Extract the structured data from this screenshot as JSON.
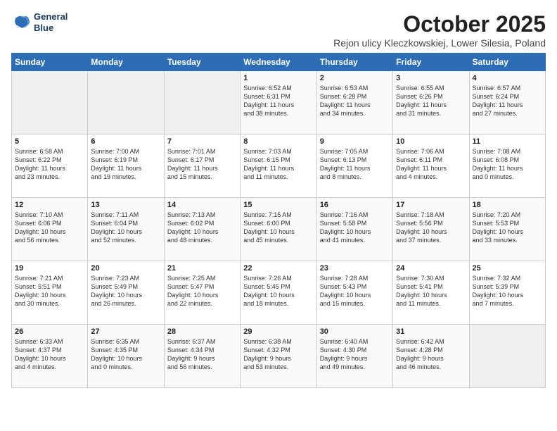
{
  "header": {
    "logo_line1": "General",
    "logo_line2": "Blue",
    "month": "October 2025",
    "location": "Rejon ulicy Kleczkowskiej, Lower Silesia, Poland"
  },
  "days_of_week": [
    "Sunday",
    "Monday",
    "Tuesday",
    "Wednesday",
    "Thursday",
    "Friday",
    "Saturday"
  ],
  "weeks": [
    [
      {
        "day": "",
        "empty": true
      },
      {
        "day": "",
        "empty": true
      },
      {
        "day": "",
        "empty": true
      },
      {
        "day": "1",
        "sunrise": "6:52 AM",
        "sunset": "6:31 PM",
        "daylight": "11 hours and 38 minutes."
      },
      {
        "day": "2",
        "sunrise": "6:53 AM",
        "sunset": "6:28 PM",
        "daylight": "11 hours and 34 minutes."
      },
      {
        "day": "3",
        "sunrise": "6:55 AM",
        "sunset": "6:26 PM",
        "daylight": "11 hours and 31 minutes."
      },
      {
        "day": "4",
        "sunrise": "6:57 AM",
        "sunset": "6:24 PM",
        "daylight": "11 hours and 27 minutes."
      }
    ],
    [
      {
        "day": "5",
        "sunrise": "6:58 AM",
        "sunset": "6:22 PM",
        "daylight": "11 hours and 23 minutes."
      },
      {
        "day": "6",
        "sunrise": "7:00 AM",
        "sunset": "6:19 PM",
        "daylight": "11 hours and 19 minutes."
      },
      {
        "day": "7",
        "sunrise": "7:01 AM",
        "sunset": "6:17 PM",
        "daylight": "11 hours and 15 minutes."
      },
      {
        "day": "8",
        "sunrise": "7:03 AM",
        "sunset": "6:15 PM",
        "daylight": "11 hours and 11 minutes."
      },
      {
        "day": "9",
        "sunrise": "7:05 AM",
        "sunset": "6:13 PM",
        "daylight": "11 hours and 8 minutes."
      },
      {
        "day": "10",
        "sunrise": "7:06 AM",
        "sunset": "6:11 PM",
        "daylight": "11 hours and 4 minutes."
      },
      {
        "day": "11",
        "sunrise": "7:08 AM",
        "sunset": "6:08 PM",
        "daylight": "11 hours and 0 minutes."
      }
    ],
    [
      {
        "day": "12",
        "sunrise": "7:10 AM",
        "sunset": "6:06 PM",
        "daylight": "10 hours and 56 minutes."
      },
      {
        "day": "13",
        "sunrise": "7:11 AM",
        "sunset": "6:04 PM",
        "daylight": "10 hours and 52 minutes."
      },
      {
        "day": "14",
        "sunrise": "7:13 AM",
        "sunset": "6:02 PM",
        "daylight": "10 hours and 48 minutes."
      },
      {
        "day": "15",
        "sunrise": "7:15 AM",
        "sunset": "6:00 PM",
        "daylight": "10 hours and 45 minutes."
      },
      {
        "day": "16",
        "sunrise": "7:16 AM",
        "sunset": "5:58 PM",
        "daylight": "10 hours and 41 minutes."
      },
      {
        "day": "17",
        "sunrise": "7:18 AM",
        "sunset": "5:56 PM",
        "daylight": "10 hours and 37 minutes."
      },
      {
        "day": "18",
        "sunrise": "7:20 AM",
        "sunset": "5:53 PM",
        "daylight": "10 hours and 33 minutes."
      }
    ],
    [
      {
        "day": "19",
        "sunrise": "7:21 AM",
        "sunset": "5:51 PM",
        "daylight": "10 hours and 30 minutes."
      },
      {
        "day": "20",
        "sunrise": "7:23 AM",
        "sunset": "5:49 PM",
        "daylight": "10 hours and 26 minutes."
      },
      {
        "day": "21",
        "sunrise": "7:25 AM",
        "sunset": "5:47 PM",
        "daylight": "10 hours and 22 minutes."
      },
      {
        "day": "22",
        "sunrise": "7:26 AM",
        "sunset": "5:45 PM",
        "daylight": "10 hours and 18 minutes."
      },
      {
        "day": "23",
        "sunrise": "7:28 AM",
        "sunset": "5:43 PM",
        "daylight": "10 hours and 15 minutes."
      },
      {
        "day": "24",
        "sunrise": "7:30 AM",
        "sunset": "5:41 PM",
        "daylight": "10 hours and 11 minutes."
      },
      {
        "day": "25",
        "sunrise": "7:32 AM",
        "sunset": "5:39 PM",
        "daylight": "10 hours and 7 minutes."
      }
    ],
    [
      {
        "day": "26",
        "sunrise": "6:33 AM",
        "sunset": "4:37 PM",
        "daylight": "10 hours and 4 minutes."
      },
      {
        "day": "27",
        "sunrise": "6:35 AM",
        "sunset": "4:35 PM",
        "daylight": "10 hours and 0 minutes."
      },
      {
        "day": "28",
        "sunrise": "6:37 AM",
        "sunset": "4:34 PM",
        "daylight": "9 hours and 56 minutes."
      },
      {
        "day": "29",
        "sunrise": "6:38 AM",
        "sunset": "4:32 PM",
        "daylight": "9 hours and 53 minutes."
      },
      {
        "day": "30",
        "sunrise": "6:40 AM",
        "sunset": "4:30 PM",
        "daylight": "9 hours and 49 minutes."
      },
      {
        "day": "31",
        "sunrise": "6:42 AM",
        "sunset": "4:28 PM",
        "daylight": "9 hours and 46 minutes."
      },
      {
        "day": "",
        "empty": true
      }
    ]
  ]
}
